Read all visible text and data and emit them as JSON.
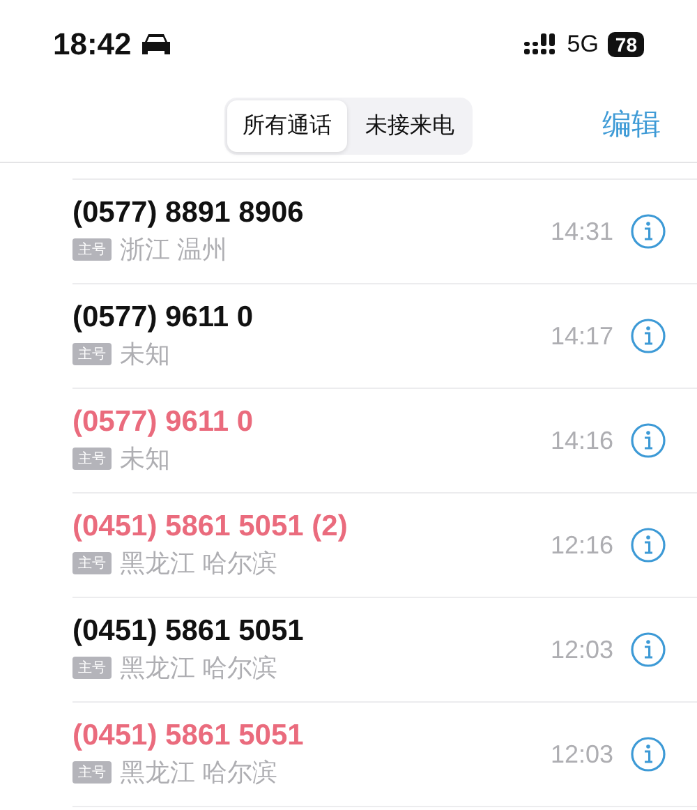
{
  "status_bar": {
    "time": "18:42",
    "network": "5G",
    "battery": "78"
  },
  "tabs": [
    {
      "label": "所有通话",
      "selected": true
    },
    {
      "label": "未接来电",
      "selected": false
    }
  ],
  "edit_button": "编辑",
  "calls": [
    {
      "number": "(0577) 8891 8906",
      "badge": "主号",
      "location": "浙江 温州",
      "time": "14:31",
      "missed": false
    },
    {
      "number": "(0577) 9611 0",
      "badge": "主号",
      "location": "未知",
      "time": "14:17",
      "missed": false
    },
    {
      "number": "(0577) 9611 0",
      "badge": "主号",
      "location": "未知",
      "time": "14:16",
      "missed": true
    },
    {
      "number": "(0451) 5861 5051 (2)",
      "badge": "主号",
      "location": "黑龙江 哈尔滨",
      "time": "12:16",
      "missed": true
    },
    {
      "number": "(0451) 5861 5051",
      "badge": "主号",
      "location": "黑龙江 哈尔滨",
      "time": "12:03",
      "missed": false
    },
    {
      "number": "(0451) 5861 5051",
      "badge": "主号",
      "location": "黑龙江 哈尔滨",
      "time": "12:03",
      "missed": true
    }
  ]
}
